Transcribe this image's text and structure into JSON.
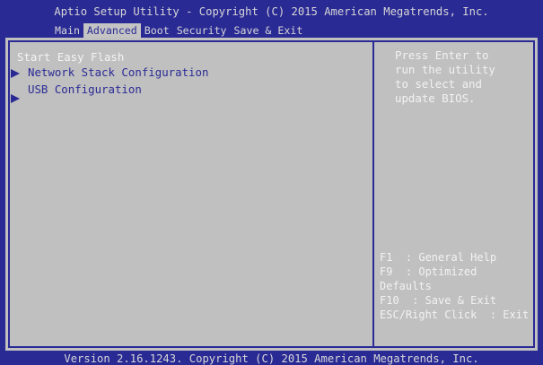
{
  "header": {
    "title": "Aptio Setup Utility - Copyright (C) 2015 American Megatrends, Inc."
  },
  "menu": {
    "tabs": [
      {
        "label": "Main"
      },
      {
        "label": "Advanced"
      },
      {
        "label": "Boot"
      },
      {
        "label": "Security"
      },
      {
        "label": "Save & Exit"
      }
    ],
    "active": "Advanced"
  },
  "items": [
    {
      "label": "Start Easy Flash",
      "selected": true
    },
    {
      "label": "Network Stack Configuration",
      "submenu": true
    },
    {
      "label": "USB Configuration",
      "submenu": true
    }
  ],
  "help": {
    "lines": [
      "Press Enter to",
      "run the utility",
      "to select and",
      "update BIOS."
    ]
  },
  "keys": {
    "lines": [
      "F1  : General Help",
      "F9  : Optimized",
      "Defaults",
      "F10  : Save & Exit",
      "ESC/Right Click  : Exit"
    ]
  },
  "footer": {
    "text": "Version 2.16.1243. Copyright (C) 2015 American Megatrends, Inc."
  },
  "colors": {
    "background": "#2a2a95",
    "panel": "#c0c0c0",
    "highlight_text": "#f4f4f4",
    "normal_text": "#2a2a95"
  },
  "icons": [
    "submenu-arrow-icon"
  ]
}
